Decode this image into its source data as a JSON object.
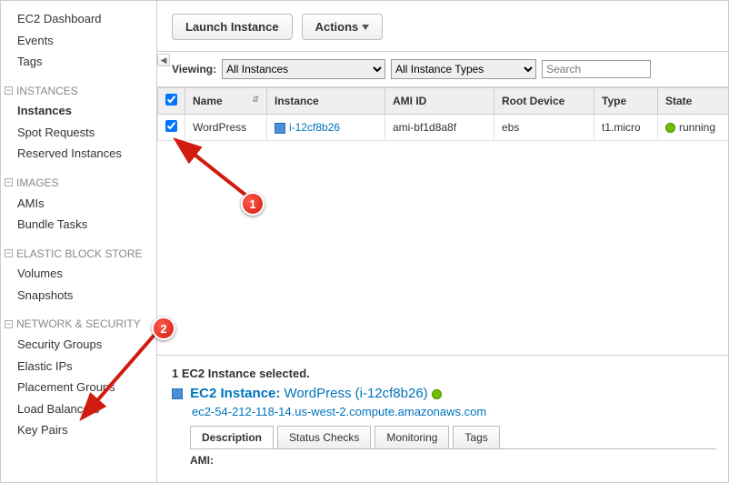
{
  "sidebar": {
    "top": [
      "EC2 Dashboard",
      "Events",
      "Tags"
    ],
    "groups": [
      {
        "label": "INSTANCES",
        "items": [
          "Instances",
          "Spot Requests",
          "Reserved Instances"
        ],
        "active": "Instances"
      },
      {
        "label": "IMAGES",
        "items": [
          "AMIs",
          "Bundle Tasks"
        ]
      },
      {
        "label": "ELASTIC BLOCK STORE",
        "items": [
          "Volumes",
          "Snapshots"
        ]
      },
      {
        "label": "NETWORK & SECURITY",
        "items": [
          "Security Groups",
          "Elastic IPs",
          "Placement Groups",
          "Load Balancers",
          "Key Pairs"
        ]
      }
    ]
  },
  "toolbar": {
    "launch": "Launch Instance",
    "actions": "Actions"
  },
  "viewing": {
    "label": "Viewing:",
    "option_all_instances": "All Instances",
    "option_all_types": "All Instance Types",
    "search_placeholder": "Search"
  },
  "table": {
    "headers": {
      "name": "Name",
      "instance": "Instance",
      "ami": "AMI ID",
      "root": "Root Device",
      "type": "Type",
      "state": "State"
    },
    "rows": [
      {
        "checked": true,
        "name": "WordPress",
        "instance": "i-12cf8b26",
        "ami": "ami-bf1d8a8f",
        "root": "ebs",
        "type": "t1.micro",
        "state": "running"
      }
    ]
  },
  "detail": {
    "selected": "1 EC2 Instance selected.",
    "title_prefix": "EC2 Instance:",
    "title_value": "WordPress (i-12cf8b26)",
    "dns": "ec2-54-212-118-14.us-west-2.compute.amazonaws.com",
    "tabs": [
      "Description",
      "Status Checks",
      "Monitoring",
      "Tags"
    ],
    "active_tab": "Description",
    "ami_label": "AMI:"
  },
  "annotations": {
    "b1": "1",
    "b2": "2"
  }
}
